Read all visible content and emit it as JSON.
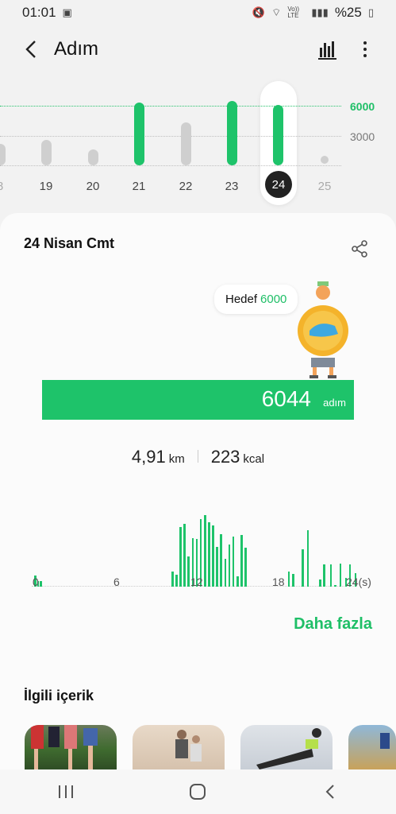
{
  "status": {
    "time": "01:01",
    "battery": "%25",
    "network": "Vo)) LTE"
  },
  "appbar": {
    "title": "Adım"
  },
  "day_chart": {
    "grid_labels": [
      "6000",
      "3000"
    ],
    "days": [
      {
        "label": "8",
        "steps": 2200
      },
      {
        "label": "19",
        "steps": 2600
      },
      {
        "label": "20",
        "steps": 1600
      },
      {
        "label": "21",
        "steps": 6300
      },
      {
        "label": "22",
        "steps": 4300
      },
      {
        "label": "23",
        "steps": 6500
      },
      {
        "label": "24",
        "steps": 6044
      },
      {
        "label": "25",
        "steps": 0
      }
    ],
    "selected": "24",
    "goal": 6000
  },
  "summary": {
    "date_title": "24 Nisan Cmt",
    "goal_label": "Hedef",
    "goal_value": "6000",
    "steps_value": "6044",
    "steps_unit": "adım",
    "distance_value": "4,91",
    "distance_unit": "km",
    "calories_value": "223",
    "calories_unit": "kcal"
  },
  "hour_chart": {
    "labels": [
      "0",
      "6",
      "12",
      "18",
      "24(s)"
    ],
    "bars": [
      {
        "h": 0.2,
        "v": 0.15
      },
      {
        "h": 0.4,
        "v": 0.07
      },
      {
        "h": 0.6,
        "v": 0.07
      },
      {
        "h": 10.3,
        "v": 0.2
      },
      {
        "h": 10.6,
        "v": 0.16
      },
      {
        "h": 10.9,
        "v": 0.79
      },
      {
        "h": 11.2,
        "v": 0.83
      },
      {
        "h": 11.5,
        "v": 0.4
      },
      {
        "h": 11.8,
        "v": 0.64
      },
      {
        "h": 12.1,
        "v": 0.63
      },
      {
        "h": 12.4,
        "v": 0.89
      },
      {
        "h": 12.7,
        "v": 0.95
      },
      {
        "h": 13.0,
        "v": 0.85
      },
      {
        "h": 13.3,
        "v": 0.81
      },
      {
        "h": 13.6,
        "v": 0.53
      },
      {
        "h": 13.9,
        "v": 0.7
      },
      {
        "h": 14.2,
        "v": 0.37
      },
      {
        "h": 14.5,
        "v": 0.56
      },
      {
        "h": 14.8,
        "v": 0.66
      },
      {
        "h": 15.1,
        "v": 0.14
      },
      {
        "h": 15.4,
        "v": 0.68
      },
      {
        "h": 15.7,
        "v": 0.52
      },
      {
        "h": 18.9,
        "v": 0.2
      },
      {
        "h": 19.2,
        "v": 0.17
      },
      {
        "h": 19.9,
        "v": 0.5
      },
      {
        "h": 20.3,
        "v": 0.75
      },
      {
        "h": 21.2,
        "v": 0.09
      },
      {
        "h": 21.5,
        "v": 0.3
      },
      {
        "h": 22.0,
        "v": 0.29
      },
      {
        "h": 22.3,
        "v": 0.02
      },
      {
        "h": 22.7,
        "v": 0.31
      },
      {
        "h": 23.1,
        "v": 0.12
      },
      {
        "h": 23.4,
        "v": 0.3
      },
      {
        "h": 23.8,
        "v": 0.18
      }
    ]
  },
  "more_link": "Daha fazla",
  "related": {
    "title": "İlgili içerik"
  }
}
